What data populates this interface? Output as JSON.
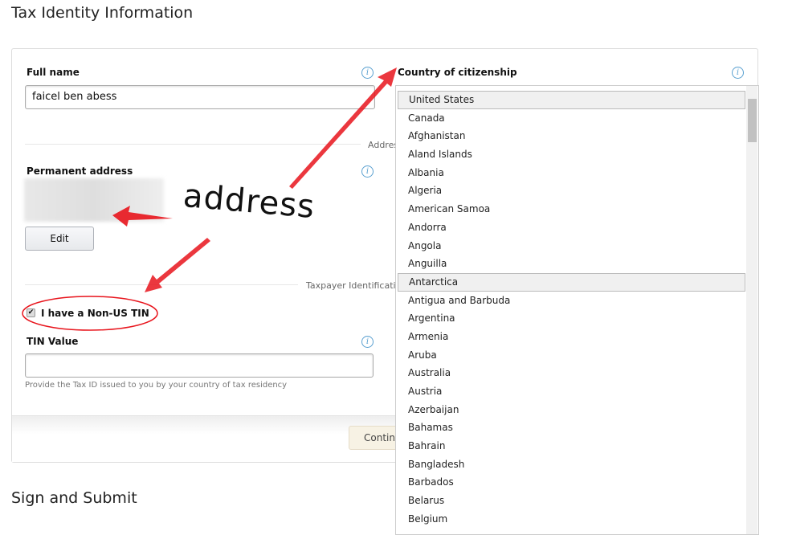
{
  "page": {
    "title": "Tax Identity Information",
    "next_section": "Sign and Submit"
  },
  "form": {
    "full_name": {
      "label": "Full name",
      "value": "faicel ben abess"
    },
    "address_section": "Address",
    "permanent_address": {
      "label": "Permanent address",
      "edit": "Edit"
    },
    "tin_section": "Taxpayer Identification",
    "non_us_tin": {
      "label": "I have a Non-US TIN",
      "checked": true
    },
    "tin_value": {
      "label": "TIN Value",
      "value": "",
      "help": "Provide the Tax ID issued to you by your country of tax residency"
    },
    "continue": "Continue",
    "citizenship": {
      "label": "Country of citizenship",
      "selected": "United States"
    }
  },
  "dropdown": {
    "options": [
      "United States",
      "Canada",
      "Afghanistan",
      "Aland Islands",
      "Albania",
      "Algeria",
      "American Samoa",
      "Andorra",
      "Angola",
      "Anguilla",
      "Antarctica",
      "Antigua and Barbuda",
      "Argentina",
      "Armenia",
      "Aruba",
      "Australia",
      "Austria",
      "Azerbaijan",
      "Bahamas",
      "Bahrain",
      "Bangladesh",
      "Barbados",
      "Belarus",
      "Belgium"
    ],
    "highlighted": "Antarctica"
  },
  "annotation": {
    "text": "address",
    "color": "#e8141c"
  }
}
